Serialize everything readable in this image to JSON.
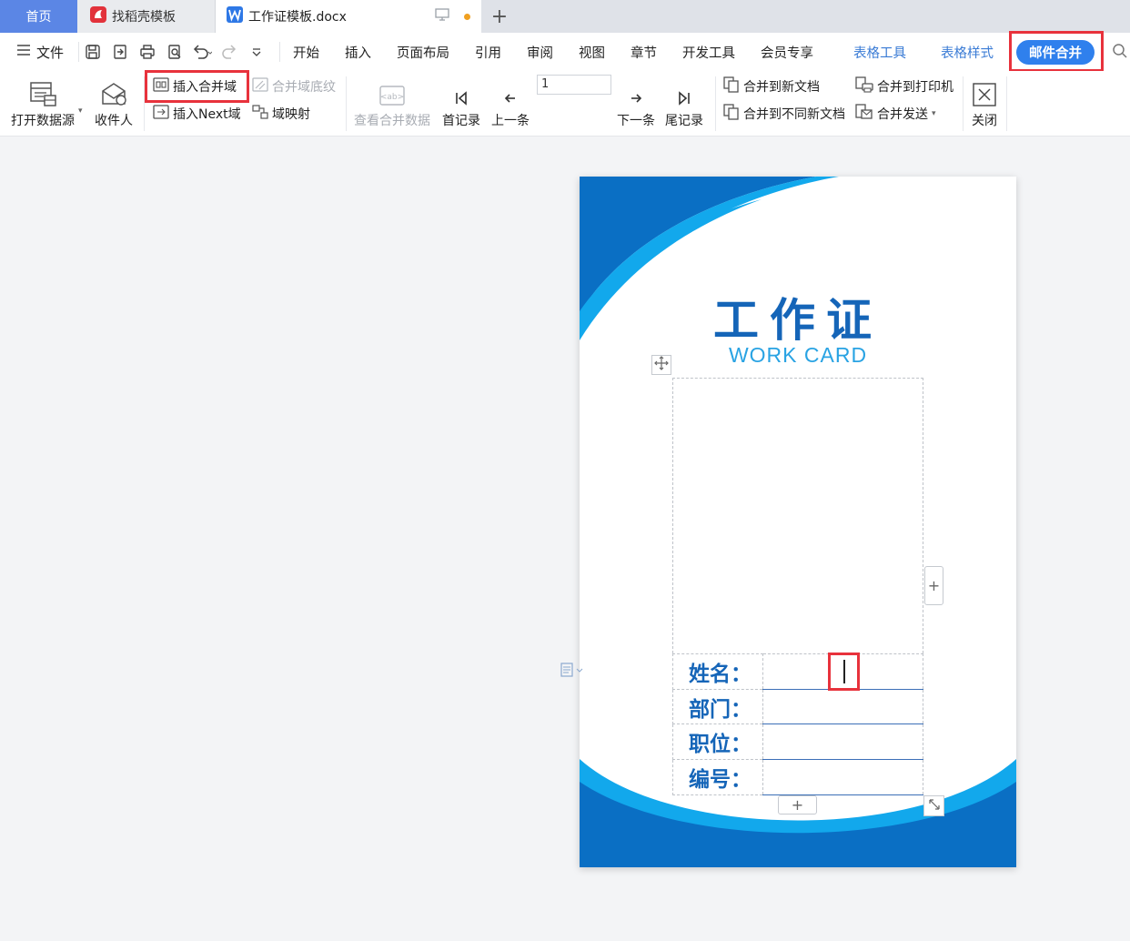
{
  "tabs": {
    "home": "首页",
    "template_store": "找稻壳模板",
    "document": "工作证模板.docx",
    "new_tab": "+"
  },
  "menu": {
    "file": "文件",
    "items": [
      "开始",
      "插入",
      "页面布局",
      "引用",
      "审阅",
      "视图",
      "章节",
      "开发工具",
      "会员专享"
    ],
    "context_items": [
      "表格工具",
      "表格样式"
    ],
    "active": "邮件合并"
  },
  "ribbon": {
    "open_data_source": "打开数据源",
    "recipients": "收件人",
    "insert_merge_field": "插入合并域",
    "insert_next_field": "插入Next域",
    "merge_field_shading": "合并域底纹",
    "field_mapping": "域映射",
    "view_merged_data": "查看合并数据",
    "first_record": "首记录",
    "previous": "上一条",
    "record_number": "1",
    "next": "下一条",
    "last_record": "尾记录",
    "merge_to_new_doc": "合并到新文档",
    "merge_to_different_docs": "合并到不同新文档",
    "merge_to_printer": "合并到打印机",
    "merge_send": "合并发送",
    "close": "关闭"
  },
  "card": {
    "title": "工作证",
    "subtitle": "WORK CARD",
    "fields": [
      {
        "label": "姓名："
      },
      {
        "label": "部门："
      },
      {
        "label": "职位："
      },
      {
        "label": "编号："
      }
    ]
  },
  "colors": {
    "brand_dark_blue": "#0a6fc4",
    "brand_light_blue": "#12a8ec",
    "title_blue": "#1565b8",
    "highlight_red": "#e8323c",
    "tab_home_blue": "#5b86e5",
    "mail_merge_btn": "#2f80ed"
  }
}
